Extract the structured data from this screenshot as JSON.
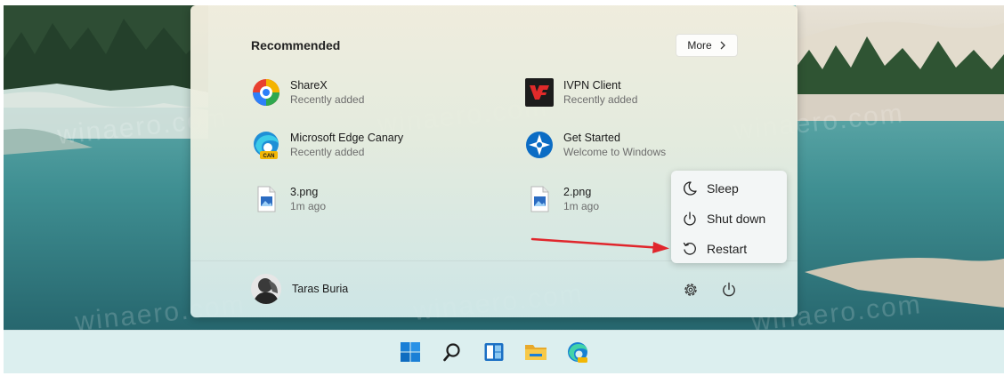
{
  "start_menu": {
    "recommended": {
      "title": "Recommended",
      "more_label": "More",
      "items": [
        {
          "name": "ShareX",
          "sub": "Recently added",
          "icon": "sharex-icon"
        },
        {
          "name": "IVPN Client",
          "sub": "Recently added",
          "icon": "ivpn-icon"
        },
        {
          "name": "Microsoft Edge Canary",
          "sub": "Recently added",
          "icon": "edge-canary-icon"
        },
        {
          "name": "Get Started",
          "sub": "Welcome to Windows",
          "icon": "get-started-icon"
        },
        {
          "name": "3.png",
          "sub": "1m ago",
          "icon": "image-file-icon"
        },
        {
          "name": "2.png",
          "sub": "1m ago",
          "icon": "image-file-icon"
        }
      ]
    },
    "user": {
      "name": "Taras Buria"
    },
    "power_menu": {
      "items": [
        {
          "label": "Sleep",
          "icon": "moon-icon"
        },
        {
          "label": "Shut down",
          "icon": "power-icon"
        },
        {
          "label": "Restart",
          "icon": "restart-icon"
        }
      ]
    }
  },
  "taskbar": {
    "icons": [
      "windows-start-icon",
      "search-icon",
      "widgets-icon",
      "file-explorer-icon",
      "edge-icon"
    ]
  },
  "watermark": "winaero.com",
  "colors": {
    "arrow": "#e0262c",
    "accent": "#0067c0",
    "menu_bg": "#f3f6f6"
  }
}
